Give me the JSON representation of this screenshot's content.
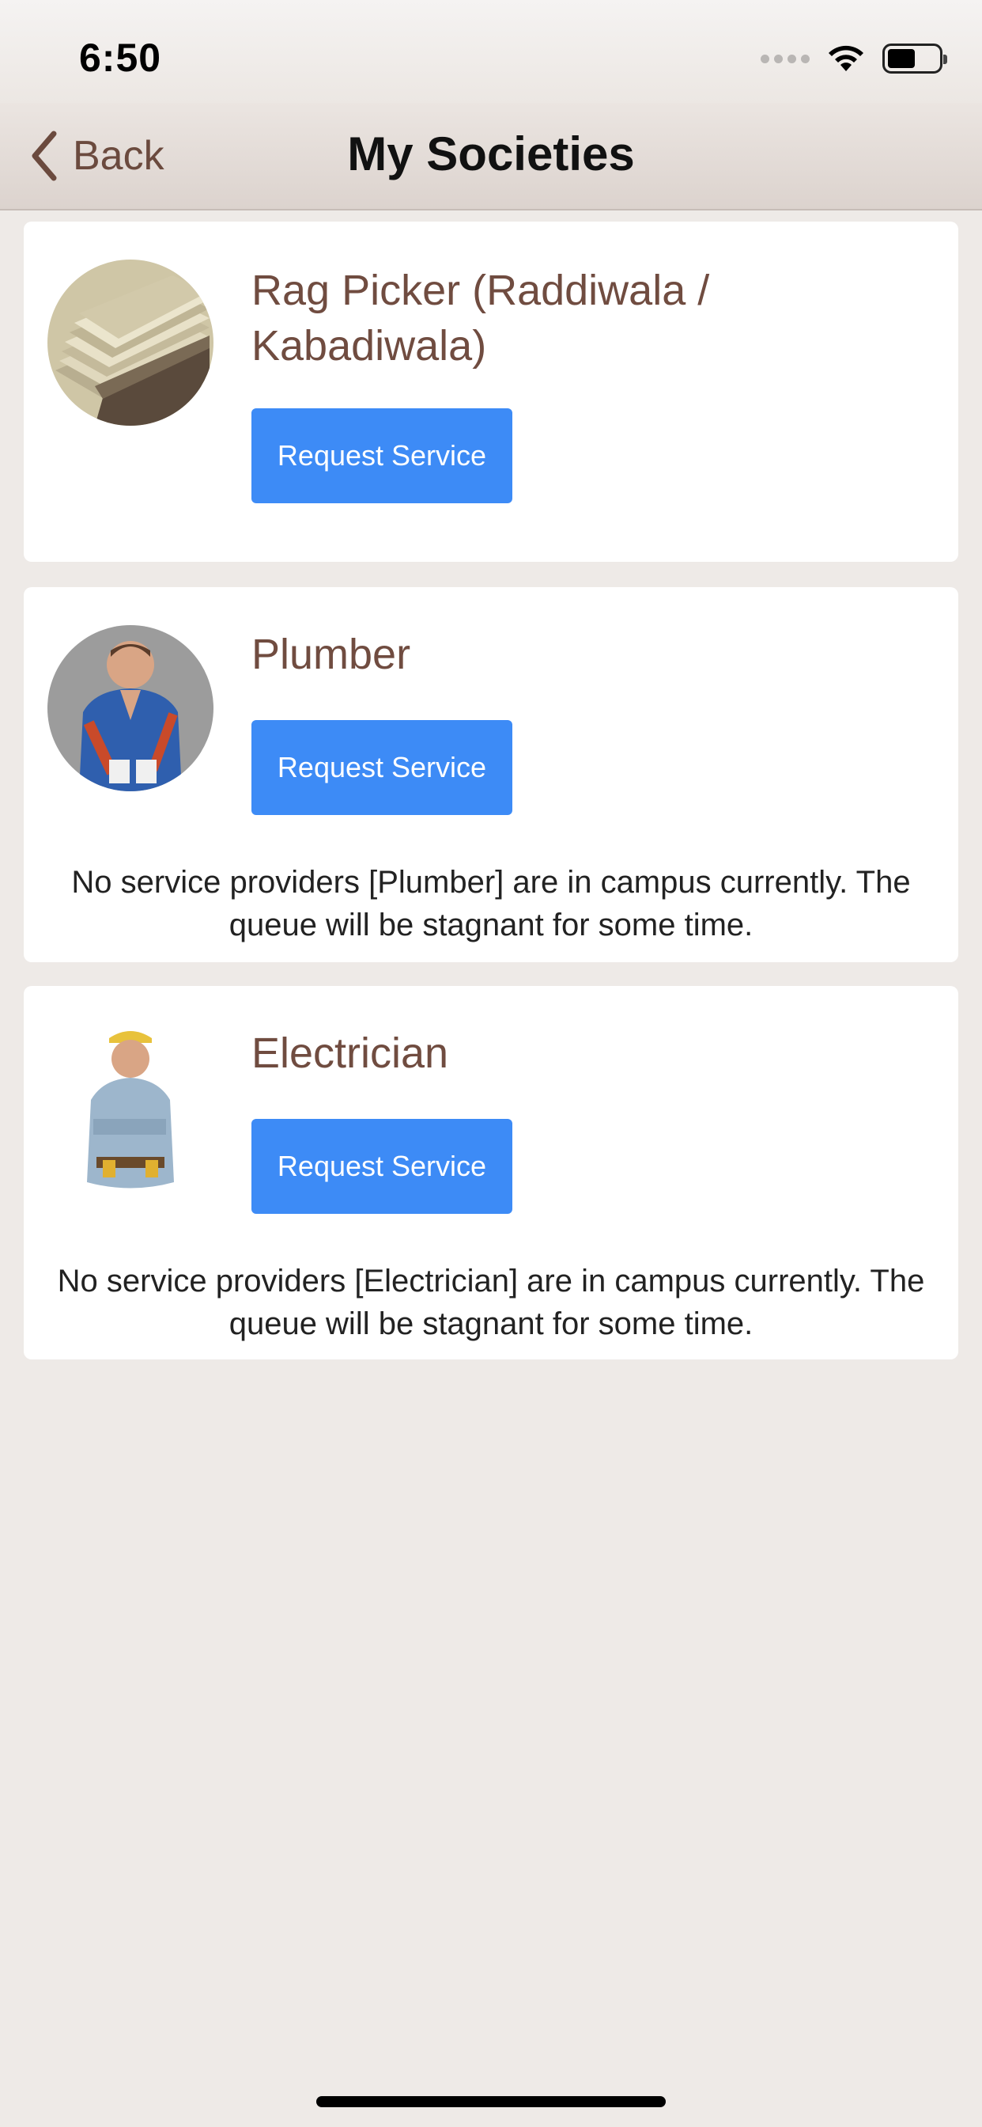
{
  "status_bar": {
    "time": "6:50"
  },
  "nav": {
    "back_label": "Back",
    "title": "My Societies"
  },
  "services": [
    {
      "title": "Rag Picker (Raddiwala / Kabadiwala)",
      "button_label": "Request Service",
      "notice": ""
    },
    {
      "title": "Plumber",
      "button_label": "Request Service",
      "notice": "No service providers [Plumber] are in campus currently. The queue will be stagnant for some time."
    },
    {
      "title": "Electrician",
      "button_label": "Request Service",
      "notice": "No service providers [Electrician] are in campus currently. The queue will be stagnant for some time."
    }
  ],
  "colors": {
    "accent_button": "#3d8bf6",
    "title_text": "#704c40",
    "background": "#eeeae7"
  }
}
